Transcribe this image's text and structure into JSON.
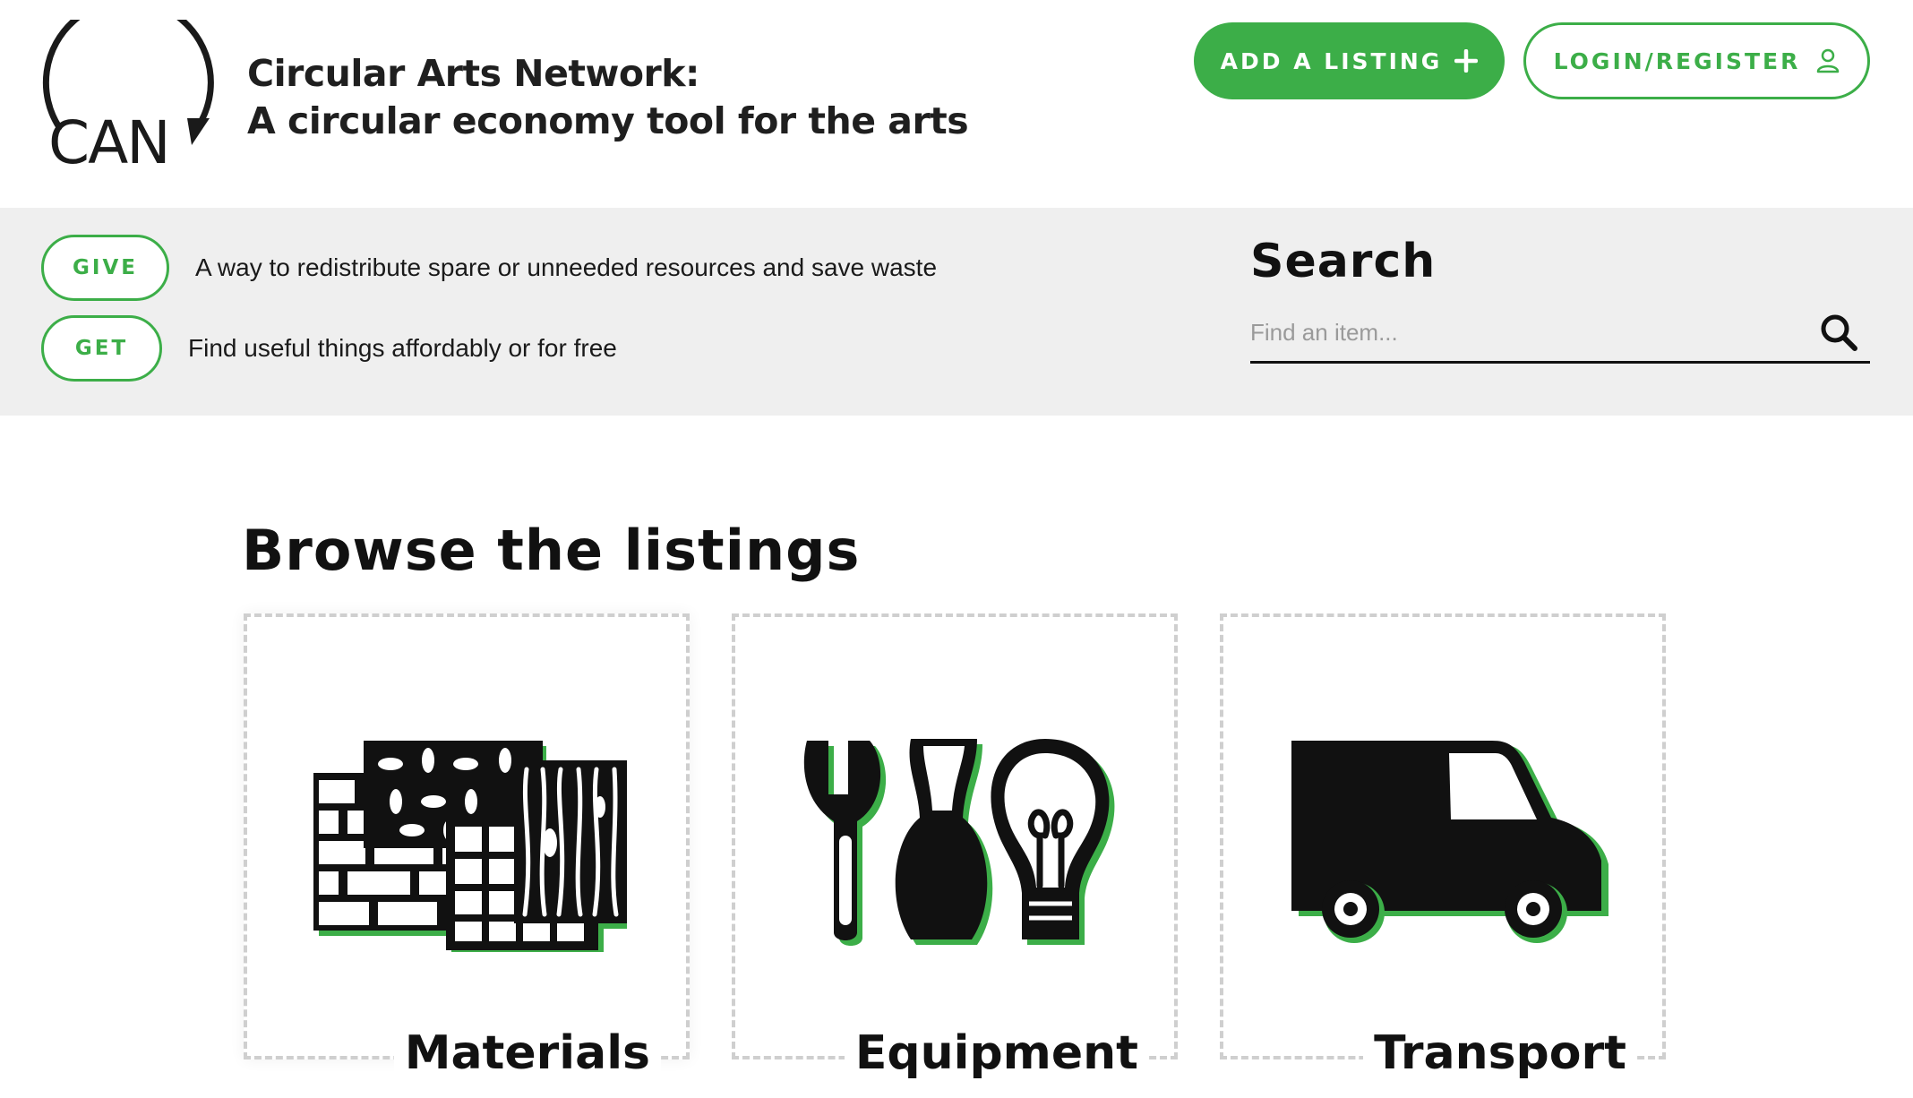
{
  "header": {
    "logo_text": "CAN",
    "title_line1": "Circular Arts Network:",
    "title_line2": "A circular economy tool for the arts",
    "add_listing_label": "ADD A LISTING",
    "add_listing_icon": "plus-icon",
    "login_label": "LOGIN/REGISTER",
    "login_icon": "user-icon"
  },
  "band": {
    "give_label": "GIVE",
    "give_text": "A way to redistribute spare or unneeded resources and save waste",
    "get_label": "GET",
    "get_text": "Find useful things affordably or for free"
  },
  "search": {
    "title": "Search",
    "placeholder": "Find an item...",
    "icon": "search-icon"
  },
  "browse": {
    "title": "Browse the listings",
    "categories": [
      {
        "label": "Materials",
        "icon": "materials-icon"
      },
      {
        "label": "Equipment",
        "icon": "equipment-icon"
      },
      {
        "label": "Transport",
        "icon": "van-icon"
      }
    ]
  },
  "colors": {
    "accent": "#3cae48",
    "band_background": "#efefef",
    "text": "#111111",
    "card_border": "#cfcfcf"
  }
}
